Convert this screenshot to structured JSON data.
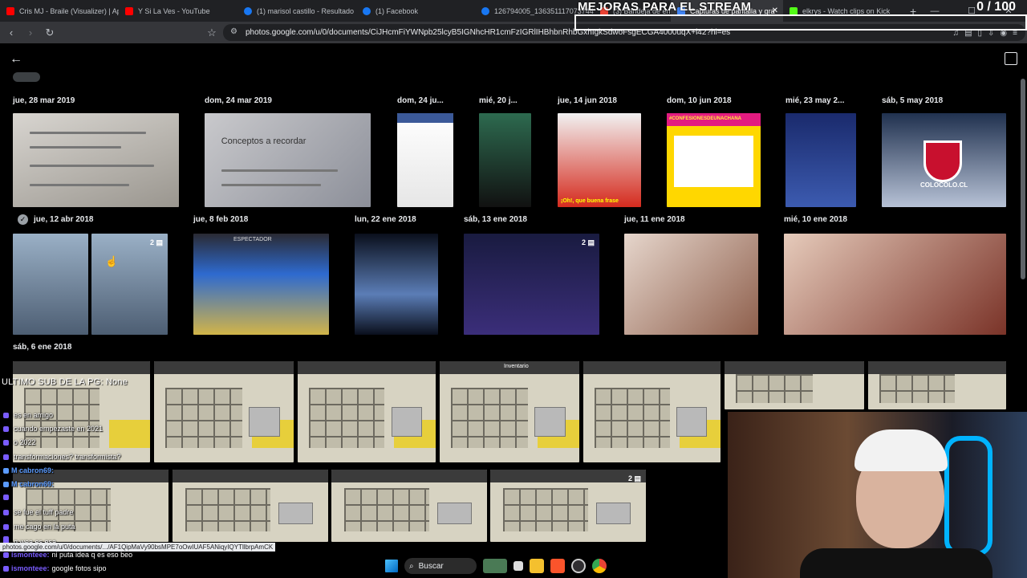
{
  "browser": {
    "tabs": [
      {
        "label": "Cris MJ - Braile (Visualizer) | Ap",
        "color": "#ff0000"
      },
      {
        "label": "Y Si La Ves - YouTube",
        "color": "#ff0000"
      },
      {
        "label": "(1) marisol castillo - Resultado",
        "color": "#1877f2"
      },
      {
        "label": "(1) Facebook",
        "color": "#1877f2"
      },
      {
        "label": "126794005_136351117073744",
        "color": "#1877f2"
      },
      {
        "label": "(3) Bandeja de entrada - Chats",
        "color": "#ea4335"
      },
      {
        "label": "Capturas de pantalla y gra",
        "color": "#4285f4"
      },
      {
        "label": "elkrys - Watch clips on Kick",
        "color": "#53fc18"
      }
    ],
    "new_tab": "+",
    "url": "photos.google.com/u/0/documents/CiJHcmFiYWNpb25lcyB5IGNhcHR1cmFzIGRlIHBhbnRhbGxhIgkSdwoFsgECGA4000uqX+l42?hl=es"
  },
  "stream_overlay": {
    "title": "MEJORAS PARA EL STREAM",
    "counter": "0 / 100"
  },
  "photos": {
    "dates": {
      "d1": "jue, 28 mar 2019",
      "d2": "dom, 24 mar 2019",
      "d3": "dom, 24 ju...",
      "d4": "mié, 20 j...",
      "d5": "jue, 14 jun 2018",
      "d6": "dom, 10 jun 2018",
      "d7": "mié, 23 may 2...",
      "d8": "sáb, 5 may 2018",
      "d9": "jue, 12 abr 2018",
      "d10": "jue, 8 feb 2018",
      "d11": "lun, 22 ene 2018",
      "d12": "sáb, 13 ene 2018",
      "d13": "jue, 11 ene 2018",
      "d14": "mié, 10 ene 2018",
      "d15": "sáb, 6 ene 2018"
    },
    "thumb_text": {
      "conceptos": "Conceptos a recordar",
      "confesiones": "#CONFESIONESDEUNACHANA",
      "colocolo": "COLOCOLO.CL",
      "espectador": "ESPECTADOR",
      "inventario": "Inventario",
      "oh": "¡Oh!, que buena frase",
      "badge_2": "2"
    }
  },
  "chat": {
    "header": "ULTIMO SUB DE LA PG: None",
    "lines": [
      {
        "user": "",
        "text": "es en amigo",
        "color": "#7a5cff"
      },
      {
        "user": "",
        "text": "cuando empezaste en 2021",
        "color": "#7a5cff"
      },
      {
        "user": "",
        "text": "o 2022",
        "color": "#7a5cff"
      },
      {
        "user": "",
        "text": "transformaciones? transformista?",
        "color": "#7a5cff"
      },
      {
        "user": "M cabron69:",
        "text": "",
        "color": "#5b9bff"
      },
      {
        "user": "M cabron69:",
        "text": "",
        "color": "#5b9bff"
      },
      {
        "user": "",
        "text": "",
        "color": "#7a5cff"
      },
      {
        "user": "",
        "text": "se fue el tuff padre",
        "color": "#7a5cff"
      },
      {
        "user": "",
        "text": "me cago en la puta",
        "color": "#7a5cff"
      },
      {
        "user": "",
        "text": "",
        "color": "#7a5cff"
      },
      {
        "user": "",
        "text": "q wea es esa",
        "color": "#7a5cff"
      },
      {
        "user": "ismonteee:",
        "text": "ni puta idea q es eso beo",
        "color": "#7a5cff"
      },
      {
        "user": "ismonteee:",
        "text": "google fotos sipo",
        "color": "#7a5cff"
      }
    ]
  },
  "status_url": "photos.google.com/u/0/documents/.../AF1QipMaVy90bsMPE7oOwIUAF5ANiqyIQYTllbrpAmCK",
  "taskbar": {
    "search_label": "Buscar"
  }
}
